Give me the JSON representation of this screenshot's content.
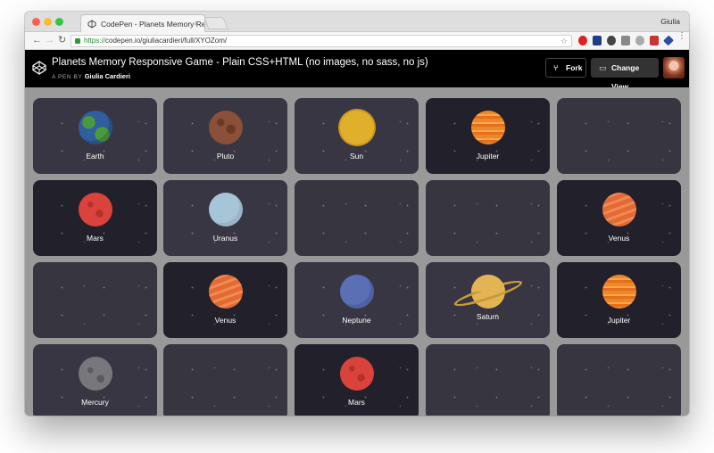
{
  "browser": {
    "tab_title": "CodePen - Planets Memory Re",
    "tab_close": "×",
    "profile_name": "Giulia",
    "url_scheme": "https://",
    "url_rest": "codepen.io/giuliacardieri/full/XYOZom/",
    "nav_back": "←",
    "nav_forward": "→",
    "nav_reload": "↻",
    "bookmark_star": "☆",
    "menu": "⋮"
  },
  "codepen": {
    "title": "Planets Memory Responsive Game - Plain CSS+HTML (no images, no sass, no js)",
    "byline_prefix": "A PEN BY",
    "author": "Giulia Cardieri",
    "fork_label": "Fork",
    "change_view_label": "Change View",
    "fork_icon": "⑂",
    "change_view_icon": "▭"
  },
  "cards": [
    {
      "state": "flipped",
      "tone": "light",
      "planet": "earth",
      "label": "Earth"
    },
    {
      "state": "flipped",
      "tone": "light",
      "planet": "pluto",
      "label": "Pluto"
    },
    {
      "state": "flipped",
      "tone": "light",
      "planet": "sun",
      "label": "Sun"
    },
    {
      "state": "flipped",
      "tone": "dark",
      "planet": "jupiter",
      "label": "Jupiter"
    },
    {
      "state": "hidden",
      "tone": "back",
      "planet": "",
      "label": ""
    },
    {
      "state": "flipped",
      "tone": "dark",
      "planet": "mars",
      "label": "Mars"
    },
    {
      "state": "flipped",
      "tone": "light",
      "planet": "uranus",
      "label": "Uranus"
    },
    {
      "state": "hidden",
      "tone": "back",
      "planet": "",
      "label": ""
    },
    {
      "state": "hidden",
      "tone": "back",
      "planet": "",
      "label": ""
    },
    {
      "state": "flipped",
      "tone": "dark",
      "planet": "venus",
      "label": "Venus"
    },
    {
      "state": "hidden",
      "tone": "back",
      "planet": "",
      "label": ""
    },
    {
      "state": "flipped",
      "tone": "dark",
      "planet": "venus",
      "label": "Venus"
    },
    {
      "state": "flipped",
      "tone": "light",
      "planet": "neptune",
      "label": "Neptune"
    },
    {
      "state": "flipped",
      "tone": "light",
      "planet": "saturn",
      "label": "Saturn"
    },
    {
      "state": "flipped",
      "tone": "dark",
      "planet": "jupiter",
      "label": "Jupiter"
    },
    {
      "state": "flipped",
      "tone": "light",
      "planet": "mercury",
      "label": "Mercury"
    },
    {
      "state": "hidden",
      "tone": "back",
      "planet": "",
      "label": ""
    },
    {
      "state": "flipped",
      "tone": "dark",
      "planet": "mars",
      "label": "Mars"
    },
    {
      "state": "hidden",
      "tone": "back",
      "planet": "",
      "label": ""
    },
    {
      "state": "hidden",
      "tone": "back",
      "planet": "",
      "label": ""
    }
  ]
}
